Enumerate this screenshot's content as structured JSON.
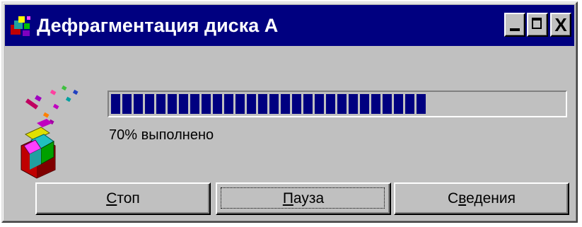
{
  "window": {
    "title": "Дефрагментация диска А",
    "icon": "defrag-icon",
    "controls": [
      "minimize-icon",
      "maximize-icon",
      "close-icon"
    ],
    "close_glyph": "X"
  },
  "progress": {
    "percent": 70,
    "status_text": "70% выполнено",
    "fill_color": "#000080"
  },
  "buttons": [
    {
      "id": "stop",
      "label": "Стоп",
      "mnemonic_index": 0
    },
    {
      "id": "pause",
      "label": "Пауза",
      "mnemonic_index": 0,
      "focused": true
    },
    {
      "id": "details",
      "label": "Сведения",
      "mnemonic_index": 1
    }
  ],
  "colors": {
    "titlebar": "#000080",
    "face": "#c0c0c0"
  }
}
